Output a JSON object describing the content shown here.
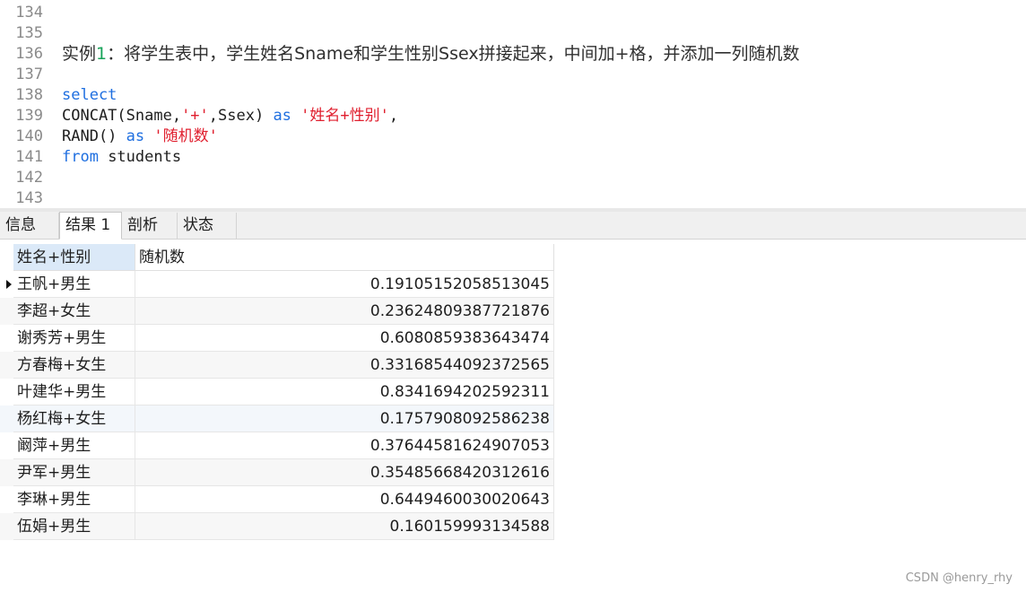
{
  "editor": {
    "line_numbers": [
      "134",
      "135",
      "136",
      "137",
      "138",
      "139",
      "140",
      "141",
      "142",
      "143"
    ],
    "comment_prefix": "实例",
    "comment_num": "1",
    "comment_text": "：将学生表中，学生姓名Sname和学生性别Ssex拼接起来，中间加+格，并添加一列随机数",
    "select_kw": "select",
    "concat_fn": "CONCAT(Sname,",
    "plus_str": "'+'",
    "concat_rest": ",Ssex) ",
    "as_kw": "as",
    "alias1": "'姓名+性别'",
    "comma": ",",
    "rand_fn": "RAND() ",
    "alias2": "'随机数'",
    "from_kw": "from",
    "table_name": " students"
  },
  "tabs": [
    {
      "label": "信息"
    },
    {
      "label": "结果 1"
    },
    {
      "label": "剖析"
    },
    {
      "label": "状态"
    }
  ],
  "grid": {
    "columns": [
      "姓名+性别",
      "随机数"
    ],
    "rows": [
      {
        "name": "王帆+男生",
        "rand": "0.19105152058513045"
      },
      {
        "name": "李超+女生",
        "rand": "0.23624809387721876"
      },
      {
        "name": "谢秀芳+男生",
        "rand": "0.6080859383643474"
      },
      {
        "name": "方春梅+女生",
        "rand": "0.33168544092372565"
      },
      {
        "name": "叶建华+男生",
        "rand": "0.834169420259231 1"
      },
      {
        "name": "杨红梅+女生",
        "rand": "0.1757908092586238"
      },
      {
        "name": "阚萍+男生",
        "rand": "0.37644581624907053"
      },
      {
        "name": "尹军+男生",
        "rand": "0.35485668420312616"
      },
      {
        "name": "李琳+男生",
        "rand": "0.6449460030020643"
      },
      {
        "name": "伍娟+男生",
        "rand": "0.160159993134588"
      }
    ]
  },
  "watermark": "CSDN @henry_rhy",
  "colors": {
    "keyword": "#1f6fe0",
    "string": "#e0202f",
    "number": "#19a35a"
  }
}
